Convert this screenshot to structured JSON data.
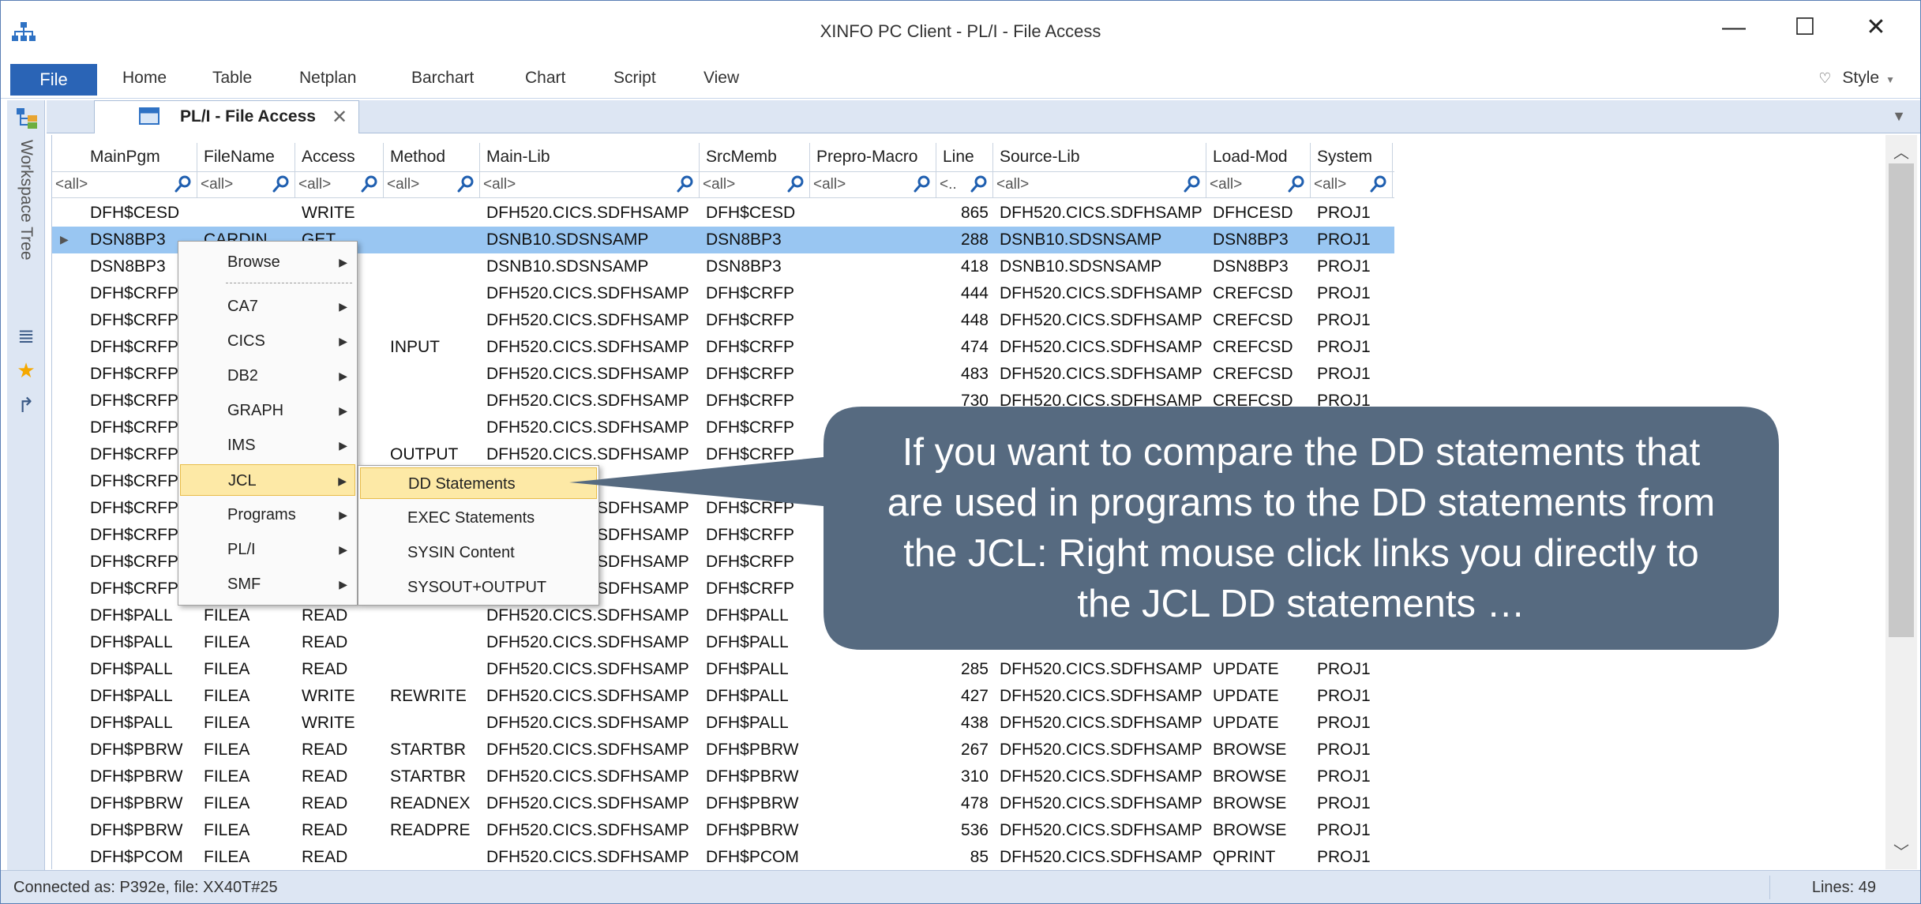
{
  "window": {
    "title": "XINFO PC Client - PL/I - File Access",
    "minimize": "—",
    "maximize": "☐",
    "close": "✕"
  },
  "ribbon": {
    "file": "File",
    "tabs": [
      "Home",
      "Table",
      "Netplan",
      "Barchart",
      "Chart",
      "Script",
      "View"
    ],
    "style": "Style"
  },
  "workspace": {
    "label": "Workspace Tree"
  },
  "doc_tab": {
    "label": "PL/I - File Access",
    "close": "✕"
  },
  "grid": {
    "columns": [
      "MainPgm",
      "FileName",
      "Access",
      "Method",
      "Main-Lib",
      "SrcMemb",
      "Prepro-Macro",
      "Line",
      "Source-Lib",
      "Load-Mod",
      "System"
    ],
    "filters": [
      "<all>",
      "<all>",
      "<all>",
      "<all>",
      "<all>",
      "<all>",
      "<all>",
      "<..",
      "<all>",
      "<all>",
      "<all>"
    ],
    "rows": [
      [
        "DFH$CESD",
        "",
        "WRITE",
        "",
        "DFH520.CICS.SDFHSAMP",
        "DFH$CESD",
        "",
        "865",
        "DFH520.CICS.SDFHSAMP",
        "DFHCESD",
        "PROJ1"
      ],
      [
        "DSN8BP3",
        "CARDIN",
        "GET",
        "",
        "DSNB10.SDSNSAMP",
        "DSN8BP3",
        "",
        "288",
        "DSNB10.SDSNSAMP",
        "DSN8BP3",
        "PROJ1"
      ],
      [
        "DSN8BP3",
        "",
        "",
        "",
        "DSNB10.SDSNSAMP",
        "DSN8BP3",
        "",
        "418",
        "DSNB10.SDSNSAMP",
        "DSN8BP3",
        "PROJ1"
      ],
      [
        "DFH$CRFP",
        "",
        "",
        "",
        "DFH520.CICS.SDFHSAMP",
        "DFH$CRFP",
        "",
        "444",
        "DFH520.CICS.SDFHSAMP",
        "CREFCSD",
        "PROJ1"
      ],
      [
        "DFH$CRFP",
        "",
        "",
        "",
        "DFH520.CICS.SDFHSAMP",
        "DFH$CRFP",
        "",
        "448",
        "DFH520.CICS.SDFHSAMP",
        "CREFCSD",
        "PROJ1"
      ],
      [
        "DFH$CRFP",
        "",
        "",
        "INPUT",
        "DFH520.CICS.SDFHSAMP",
        "DFH$CRFP",
        "",
        "474",
        "DFH520.CICS.SDFHSAMP",
        "CREFCSD",
        "PROJ1"
      ],
      [
        "DFH$CRFP",
        "",
        "",
        "",
        "DFH520.CICS.SDFHSAMP",
        "DFH$CRFP",
        "",
        "483",
        "DFH520.CICS.SDFHSAMP",
        "CREFCSD",
        "PROJ1"
      ],
      [
        "DFH$CRFP",
        "",
        "",
        "",
        "DFH520.CICS.SDFHSAMP",
        "DFH$CRFP",
        "",
        "730",
        "DFH520.CICS.SDFHSAMP",
        "CREFCSD",
        "PROJ1"
      ],
      [
        "DFH$CRFP",
        "",
        "",
        "",
        "DFH520.CICS.SDFHSAMP",
        "DFH$CRFP",
        "",
        "",
        "",
        "",
        ""
      ],
      [
        "DFH$CRFP",
        "",
        "",
        "OUTPUT",
        "DFH520.CICS.SDFHSAMP",
        "DFH$CRFP",
        "",
        "",
        "",
        "",
        ""
      ],
      [
        "DFH$CRFP",
        "",
        "",
        "",
        "",
        "",
        "",
        "",
        "",
        "",
        ""
      ],
      [
        "DFH$CRFP",
        "",
        "",
        "",
        "DFH520.CICS.SDFHSAMP",
        "DFH$CRFP",
        "",
        "",
        "",
        "",
        ""
      ],
      [
        "DFH$CRFP",
        "",
        "",
        "",
        "DFH520.CICS.SDFHSAMP",
        "DFH$CRFP",
        "",
        "",
        "",
        "",
        ""
      ],
      [
        "DFH$CRFP",
        "",
        "",
        "",
        "DFH520.CICS.SDFHSAMP",
        "DFH$CRFP",
        "",
        "",
        "",
        "",
        ""
      ],
      [
        "DFH$CRFP",
        "",
        "",
        "",
        "DFH520.CICS.SDFHSAMP",
        "DFH$CRFP",
        "",
        "",
        "",
        "",
        ""
      ],
      [
        "DFH$PALL",
        "FILEA",
        "READ",
        "",
        "DFH520.CICS.SDFHSAMP",
        "DFH$PALL",
        "",
        "",
        "",
        "",
        ""
      ],
      [
        "DFH$PALL",
        "FILEA",
        "READ",
        "",
        "DFH520.CICS.SDFHSAMP",
        "DFH$PALL",
        "",
        "",
        "",
        "",
        ""
      ],
      [
        "DFH$PALL",
        "FILEA",
        "READ",
        "",
        "DFH520.CICS.SDFHSAMP",
        "DFH$PALL",
        "",
        "285",
        "DFH520.CICS.SDFHSAMP",
        "UPDATE",
        "PROJ1"
      ],
      [
        "DFH$PALL",
        "FILEA",
        "WRITE",
        "REWRITE",
        "DFH520.CICS.SDFHSAMP",
        "DFH$PALL",
        "",
        "427",
        "DFH520.CICS.SDFHSAMP",
        "UPDATE",
        "PROJ1"
      ],
      [
        "DFH$PALL",
        "FILEA",
        "WRITE",
        "",
        "DFH520.CICS.SDFHSAMP",
        "DFH$PALL",
        "",
        "438",
        "DFH520.CICS.SDFHSAMP",
        "UPDATE",
        "PROJ1"
      ],
      [
        "DFH$PBRW",
        "FILEA",
        "READ",
        "STARTBR",
        "DFH520.CICS.SDFHSAMP",
        "DFH$PBRW",
        "",
        "267",
        "DFH520.CICS.SDFHSAMP",
        "BROWSE",
        "PROJ1"
      ],
      [
        "DFH$PBRW",
        "FILEA",
        "READ",
        "STARTBR",
        "DFH520.CICS.SDFHSAMP",
        "DFH$PBRW",
        "",
        "310",
        "DFH520.CICS.SDFHSAMP",
        "BROWSE",
        "PROJ1"
      ],
      [
        "DFH$PBRW",
        "FILEA",
        "READ",
        "READNEX",
        "DFH520.CICS.SDFHSAMP",
        "DFH$PBRW",
        "",
        "478",
        "DFH520.CICS.SDFHSAMP",
        "BROWSE",
        "PROJ1"
      ],
      [
        "DFH$PBRW",
        "FILEA",
        "READ",
        "READPRE",
        "DFH520.CICS.SDFHSAMP",
        "DFH$PBRW",
        "",
        "536",
        "DFH520.CICS.SDFHSAMP",
        "BROWSE",
        "PROJ1"
      ],
      [
        "DFH$PCOM",
        "FILEA",
        "READ",
        "",
        "DFH520.CICS.SDFHSAMP",
        "DFH$PCOM",
        "",
        "85",
        "DFH520.CICS.SDFHSAMP",
        "QPRINT",
        "PROJ1"
      ]
    ]
  },
  "context_menu": {
    "items": [
      {
        "label": "Browse"
      },
      {
        "label": "CA7"
      },
      {
        "label": "CICS"
      },
      {
        "label": "DB2"
      },
      {
        "label": "GRAPH"
      },
      {
        "label": "IMS"
      },
      {
        "label": "JCL"
      },
      {
        "label": "Programs"
      },
      {
        "label": "PL/I"
      },
      {
        "label": "SMF"
      }
    ],
    "highlighted": "JCL",
    "submenu": [
      "DD Statements",
      "EXEC Statements",
      "SYSIN Content",
      "SYSOUT+OUTPUT"
    ],
    "submenu_highlighted": "DD Statements"
  },
  "callout": {
    "lines": [
      "If you want to compare the DD statements that",
      "are used in programs to the DD statements from",
      "the JCL: Right mouse click links you directly to",
      "the JCL DD statements …"
    ],
    "color": "#566a80"
  },
  "statusbar": {
    "left": "Connected as: P392e, file: XX40T#25",
    "right": "Lines: 49"
  },
  "colors": {
    "accent": "#2a64b6",
    "selection": "#99c6f2",
    "menu_highlight": "#fde9a6",
    "chrome": "#dde6f3"
  }
}
